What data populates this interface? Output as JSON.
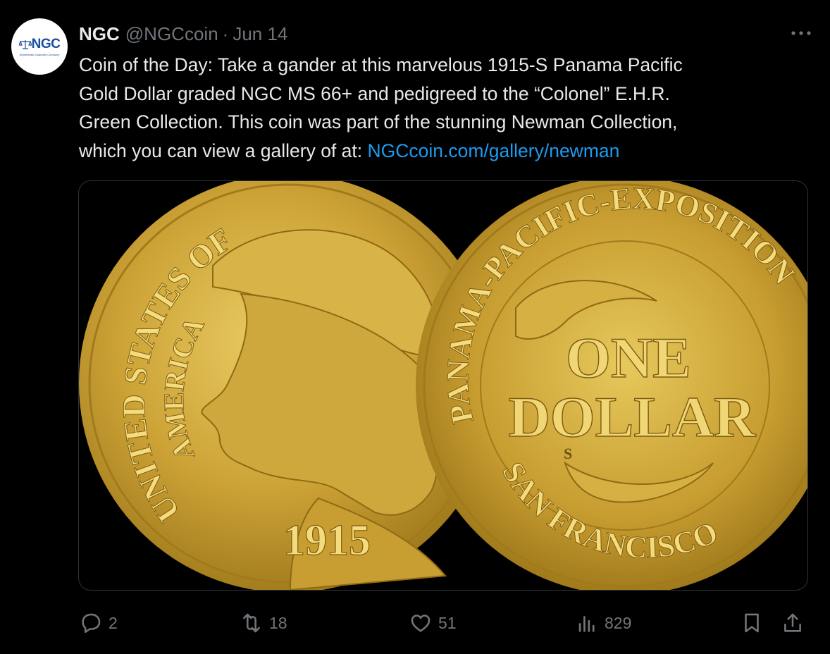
{
  "tweet": {
    "author": {
      "name": "NGC",
      "handle": "@NGCcoin",
      "avatar_logo": "NGC",
      "avatar_tagline": "Numismatic Guaranty Company"
    },
    "separator": "·",
    "date": "Jun 14",
    "text_line1": "Coin of the Day: Take a gander at this marvelous 1915-S Panama Pacific",
    "text_line2": "Gold Dollar graded NGC MS 66+ and pedigreed to the “Colonel” E.H.R.",
    "text_line3": "Green Collection. This coin was part of the stunning Newman Collection,",
    "text_line4_prefix": "which you can view a gallery of at: ",
    "link": "NGCcoin.com/gallery/newman",
    "media": {
      "obverse": {
        "legend_upper": "UNITED STATES OF",
        "legend_inner": "AMERICA",
        "date": "1915"
      },
      "reverse": {
        "legend_top": "PANAMA-PACIFIC-EXPOSITION",
        "legend_bottom": "SAN FRANCISCO",
        "denomination_line1": "ONE",
        "denomination_line2": "DOLLAR",
        "mintmark": "S"
      }
    },
    "actions": {
      "replies": "2",
      "reposts": "18",
      "likes": "51",
      "views": "829"
    },
    "icons": {
      "more": "more-icon",
      "reply": "reply-icon",
      "repost": "repost-icon",
      "like": "heart-icon",
      "views": "views-icon",
      "bookmark": "bookmark-icon",
      "share": "share-icon"
    },
    "colors": {
      "background": "#000000",
      "text": "#e7e9ea",
      "secondary": "#71767b",
      "link": "#1d9bf0",
      "gold": "#c9a338"
    }
  }
}
